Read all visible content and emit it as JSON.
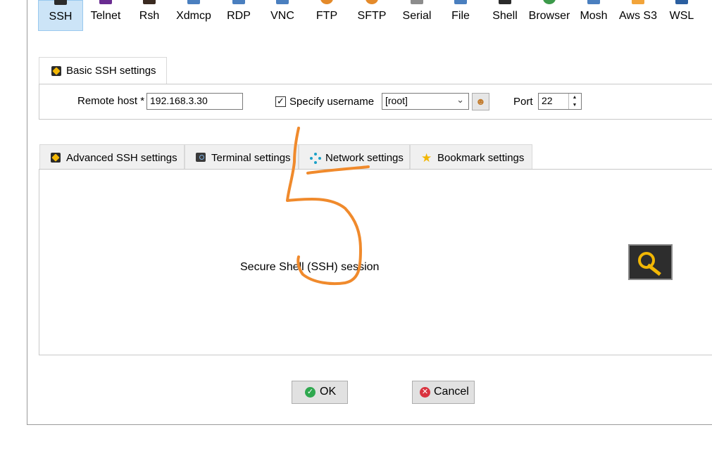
{
  "session_types": [
    {
      "label": "SSH",
      "color": "#2b2b2b"
    },
    {
      "label": "Telnet",
      "color": "#6a2c91"
    },
    {
      "label": "Rsh",
      "color": "#3a2a20"
    },
    {
      "label": "Xdmcp",
      "color": "#4a7fbf"
    },
    {
      "label": "RDP",
      "color": "#4a7fbf"
    },
    {
      "label": "VNC",
      "color": "#4a7fbf"
    },
    {
      "label": "FTP",
      "color": "#e48a2a"
    },
    {
      "label": "SFTP",
      "color": "#e48a2a"
    },
    {
      "label": "Serial",
      "color": "#8c8c8c"
    },
    {
      "label": "File",
      "color": "#4a7fbf"
    },
    {
      "label": "Shell",
      "color": "#2b2b2b"
    },
    {
      "label": "Browser",
      "color": "#3c9a4a"
    },
    {
      "label": "Mosh",
      "color": "#4a7fbf"
    },
    {
      "label": "Aws S3",
      "color": "#f2a43a"
    },
    {
      "label": "WSL",
      "color": "#2b5fa0"
    }
  ],
  "basic": {
    "tab_label": "Basic SSH settings",
    "remote_host_label": "Remote host *",
    "remote_host_value": "192.168.3.30",
    "specify_username_label": "Specify username",
    "specify_username_checked": "✓",
    "username_value": "[root]",
    "port_label": "Port",
    "port_value": "22"
  },
  "tabs": [
    {
      "label": "Advanced SSH settings"
    },
    {
      "label": "Terminal settings"
    },
    {
      "label": "Network settings"
    },
    {
      "label": "Bookmark settings"
    }
  ],
  "content": {
    "description": "Secure Shell (SSH) session"
  },
  "buttons": {
    "ok_label": "OK",
    "cancel_label": "Cancel"
  },
  "colors": {
    "active_tab_bg": "#cce4f7",
    "annotation": "#f08a2c",
    "ok_icon": "#2fa84f",
    "cancel_icon": "#d9333f"
  }
}
